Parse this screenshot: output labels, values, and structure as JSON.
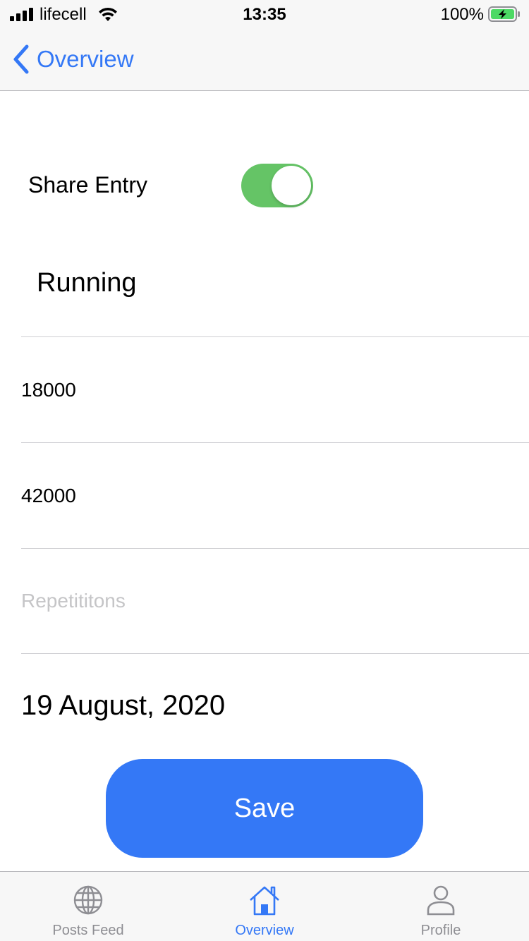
{
  "status": {
    "carrier": "lifecell",
    "time": "13:35",
    "battery": "100%"
  },
  "nav": {
    "back_label": "Overview"
  },
  "form": {
    "share_label": "Share Entry",
    "share_enabled": true,
    "exercise_name": "Running",
    "field1_value": "18000",
    "field2_value": "42000",
    "field3_placeholder": "Repetititons",
    "date": "19 August, 2020",
    "save_label": "Save"
  },
  "tabs": [
    {
      "label": "Posts Feed",
      "icon": "globe-icon"
    },
    {
      "label": "Overview",
      "icon": "home-icon",
      "active": true
    },
    {
      "label": "Profile",
      "icon": "person-icon"
    }
  ],
  "colors": {
    "accent": "#3478f6",
    "toggle_on": "#65c466",
    "inactive_tab": "#8e8e93"
  }
}
